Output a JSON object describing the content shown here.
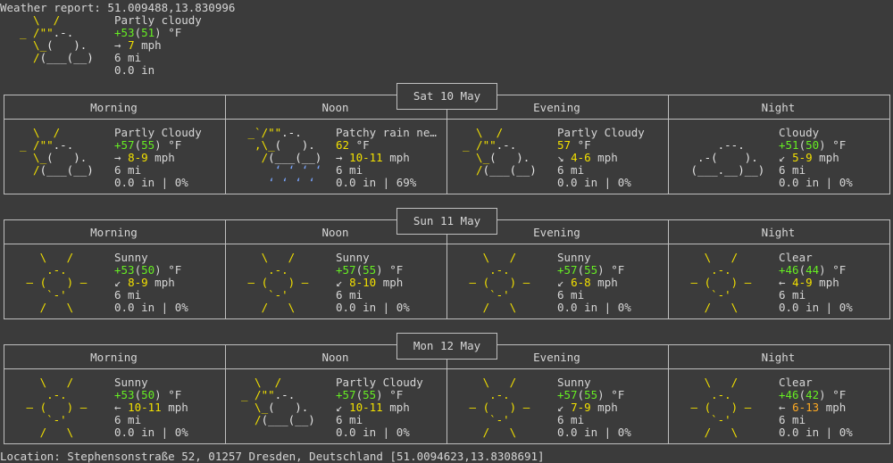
{
  "header": {
    "title": "Weather report: 51.009488,13.830996",
    "condition": "Partly cloudy",
    "temp": "+53",
    "feels": "51",
    "temp_unit": "°F",
    "wind_arrow": "→",
    "wind": "7",
    "wind_unit": "mph",
    "visibility": "6 mi",
    "precip": "0.0 in"
  },
  "periods": [
    "Morning",
    "Noon",
    "Evening",
    "Night"
  ],
  "days": [
    {
      "date": "Sat 10 May",
      "slots": [
        {
          "icon": "partly-cloudy",
          "condition": "Partly Cloudy",
          "temp": "+57",
          "feels": "55",
          "temp_unit": "°F",
          "wind_arrow": "→",
          "wind": "8-9",
          "wind_unit": "mph",
          "visibility": "6 mi",
          "precip": "0.0 in | 0%"
        },
        {
          "icon": "patchy-rain",
          "condition": "Patchy rain ne…",
          "temp": "62",
          "feels": "",
          "temp_unit": "°F",
          "wind_arrow": "→",
          "wind": "10-11",
          "wind_unit": "mph",
          "visibility": "6 mi",
          "precip": "0.0 in | 69%"
        },
        {
          "icon": "partly-cloudy",
          "condition": "Partly Cloudy",
          "temp": "57",
          "feels": "",
          "temp_unit": "°F",
          "wind_arrow": "↘",
          "wind": "4-6",
          "wind_unit": "mph",
          "visibility": "6 mi",
          "precip": "0.0 in | 0%"
        },
        {
          "icon": "cloudy",
          "condition": "Cloudy",
          "temp": "+51",
          "feels": "50",
          "temp_unit": "°F",
          "wind_arrow": "↙",
          "wind": "5-9",
          "wind_unit": "mph",
          "visibility": "6 mi",
          "precip": "0.0 in | 0%"
        }
      ]
    },
    {
      "date": "Sun 11 May",
      "slots": [
        {
          "icon": "sunny",
          "condition": "Sunny",
          "temp": "+53",
          "feels": "50",
          "temp_unit": "°F",
          "wind_arrow": "↙",
          "wind": "8-9",
          "wind_unit": "mph",
          "visibility": "6 mi",
          "precip": "0.0 in | 0%"
        },
        {
          "icon": "sunny",
          "condition": "Sunny",
          "temp": "+57",
          "feels": "55",
          "temp_unit": "°F",
          "wind_arrow": "↙",
          "wind": "8-10",
          "wind_unit": "mph",
          "visibility": "6 mi",
          "precip": "0.0 in | 0%"
        },
        {
          "icon": "sunny",
          "condition": "Sunny",
          "temp": "+57",
          "feels": "55",
          "temp_unit": "°F",
          "wind_arrow": "↙",
          "wind": "6-8",
          "wind_unit": "mph",
          "visibility": "6 mi",
          "precip": "0.0 in | 0%"
        },
        {
          "icon": "sunny",
          "condition": "Clear",
          "temp": "+46",
          "feels": "44",
          "temp_unit": "°F",
          "wind_arrow": "←",
          "wind": "4-9",
          "wind_unit": "mph",
          "visibility": "6 mi",
          "precip": "0.0 in | 0%"
        }
      ]
    },
    {
      "date": "Mon 12 May",
      "slots": [
        {
          "icon": "sunny",
          "condition": "Sunny",
          "temp": "+53",
          "feels": "50",
          "temp_unit": "°F",
          "wind_arrow": "←",
          "wind": "10-11",
          "wind_unit": "mph",
          "visibility": "6 mi",
          "precip": "0.0 in | 0%"
        },
        {
          "icon": "partly-cloudy",
          "condition": "Partly Cloudy",
          "temp": "+57",
          "feels": "55",
          "temp_unit": "°F",
          "wind_arrow": "↙",
          "wind": "10-11",
          "wind_unit": "mph",
          "visibility": "6 mi",
          "precip": "0.0 in | 0%"
        },
        {
          "icon": "sunny",
          "condition": "Sunny",
          "temp": "+57",
          "feels": "55",
          "temp_unit": "°F",
          "wind_arrow": "↙",
          "wind": "7-9",
          "wind_unit": "mph",
          "visibility": "6 mi",
          "precip": "0.0 in | 0%"
        },
        {
          "icon": "sunny",
          "condition": "Clear",
          "temp": "+46",
          "feels": "42",
          "temp_unit": "°F",
          "wind_arrow": "←",
          "wind": "6-13",
          "wind_unit": "mph",
          "visibility": "6 mi",
          "precip": "0.0 in | 0%"
        }
      ]
    }
  ],
  "footer": {
    "location": "Location: Stephensonstraße 52, 01257 Dresden, Deutschland [51.0094623,13.8308691]"
  },
  "colors": {
    "background": "#3b3b3b",
    "text": "#d6d6d6",
    "sun": "#f2e000",
    "temp_warm": "#66ee22",
    "wind_strong": "#ffaa22",
    "rain": "#7aa6ff"
  }
}
